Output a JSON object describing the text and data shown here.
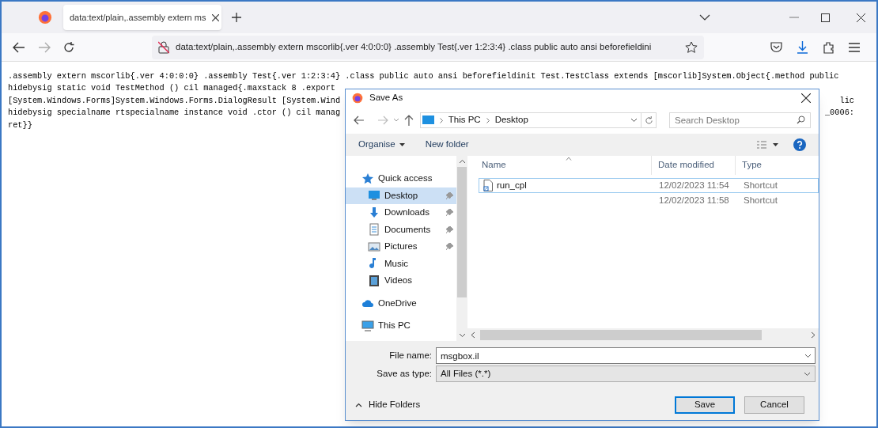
{
  "browser": {
    "tab": {
      "title": "data:text/plain,.assembly extern ms",
      "selected": true
    },
    "address": "data:text/plain,.assembly extern mscorlib{.ver 4:0:0:0} .assembly Test{.ver 1:2:3:4} .class public auto ansi beforefieldini"
  },
  "page_lines": [
    {
      "left": ".assembly extern mscorlib{.ver 4:0:0:0} .assembly Test{.ver 1:2:3:4} .class public auto ansi beforefieldinit Test.TestClass extends [mscorlib]System.Object{.method public"
    },
    {
      "left": "hidebysig static void TestMethod () cil managed{.maxstack 8 .export"
    },
    {
      "left": "[System.Windows.Forms]System.Windows.Forms.DialogResult [System.Wind",
      "right": "lic"
    },
    {
      "left": "hidebysig specialname rtspecialname instance void .ctor () cil manag",
      "right": "_0006:"
    },
    {
      "left": "ret}}"
    }
  ],
  "dialog": {
    "title": "Save As",
    "path": [
      "This PC",
      "Desktop"
    ],
    "search": {
      "placeholder": "Search Desktop"
    },
    "toolbar": [
      "Organise",
      "New folder"
    ],
    "nav": [
      {
        "label": "Quick access",
        "kind": "star",
        "selected": false,
        "children": [
          {
            "label": "Desktop",
            "kind": "desktop",
            "selected": true,
            "pinned": true
          },
          {
            "label": "Downloads",
            "kind": "download",
            "selected": false,
            "pinned": true
          },
          {
            "label": "Documents",
            "kind": "document",
            "selected": false,
            "pinned": true
          },
          {
            "label": "Pictures",
            "kind": "pictures",
            "selected": false,
            "pinned": true
          },
          {
            "label": "Music",
            "kind": "music",
            "selected": false,
            "pinned": false
          },
          {
            "label": "Videos",
            "kind": "videos",
            "selected": false,
            "pinned": false
          }
        ]
      },
      {
        "label": "OneDrive",
        "kind": "cloud",
        "selected": false
      },
      {
        "label": "This PC",
        "kind": "pc",
        "selected": false
      }
    ],
    "columns": [
      "Name",
      "Date modified",
      "Type"
    ],
    "files": [
      {
        "name": "run_cpl",
        "date": "12/02/2023 11:54",
        "type": "Shortcut",
        "selected": true
      },
      {
        "date": "12/02/2023 11:58",
        "type": "Shortcut",
        "selected": false
      }
    ],
    "file_name": "msgbox.il",
    "save_as_type": "All Files (*.*)",
    "file_name_label": "File name:",
    "type_label": "Save as type:",
    "hide_folders": "Hide Folders",
    "buttons": [
      "Save",
      "Cancel"
    ]
  }
}
